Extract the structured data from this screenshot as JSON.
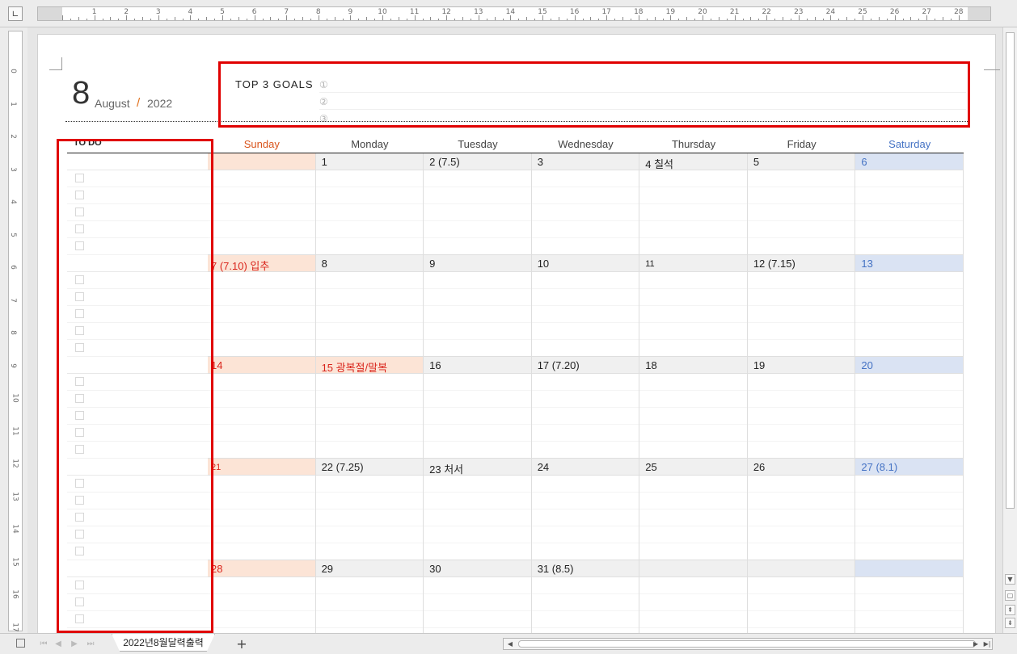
{
  "ruler": {
    "corner_icon": "tab-stop-icon",
    "numbers": [
      "1",
      "2",
      "3",
      "4",
      "5",
      "6",
      "7",
      "8",
      "9",
      "10",
      "11",
      "12",
      "13",
      "14",
      "15",
      "16",
      "17",
      "18",
      "19",
      "20",
      "21",
      "22",
      "23",
      "24",
      "25",
      "26",
      "27",
      "28"
    ],
    "vnumbers": [
      "0",
      "1",
      "2",
      "3",
      "4",
      "5",
      "6",
      "7",
      "8",
      "9",
      "10",
      "11",
      "12",
      "13",
      "14",
      "15",
      "16",
      "17"
    ]
  },
  "calendar": {
    "month_number": "8",
    "month_name": "August",
    "separator": "/",
    "year": "2022",
    "goals_title": "TOP  3  GOALS",
    "goal_marks": [
      "①",
      "②",
      "③"
    ],
    "todo_label": "TO  DO",
    "days": [
      "Sunday",
      "Monday",
      "Tuesday",
      "Wednesday",
      "Thursday",
      "Friday",
      "Saturday"
    ],
    "weeks": [
      [
        "",
        "1",
        "2  (7.5)",
        "3",
        "4  칠석",
        "5",
        "6"
      ],
      [
        "7  (7.10)  입추",
        "8",
        "9",
        "10",
        "11",
        "12  (7.15)",
        "13"
      ],
      [
        "14",
        "15  광복절/말복",
        "16",
        "17  (7.20)",
        "18",
        "19",
        "20"
      ],
      [
        "21",
        "22  (7.25)",
        "23  처서",
        "24",
        "25",
        "26",
        "27  (8.1)"
      ],
      [
        "28",
        "29",
        "30",
        "31  (8.5)",
        "",
        "",
        ""
      ]
    ],
    "holiday_cells": [
      "15  광복절/말복"
    ]
  },
  "colors": {
    "sunday": "#d9541b",
    "saturday": "#4472c4",
    "highlight": "#e00000"
  },
  "bottom": {
    "sheet_tab": "2022년8월달력출력",
    "add_tab": "+"
  }
}
